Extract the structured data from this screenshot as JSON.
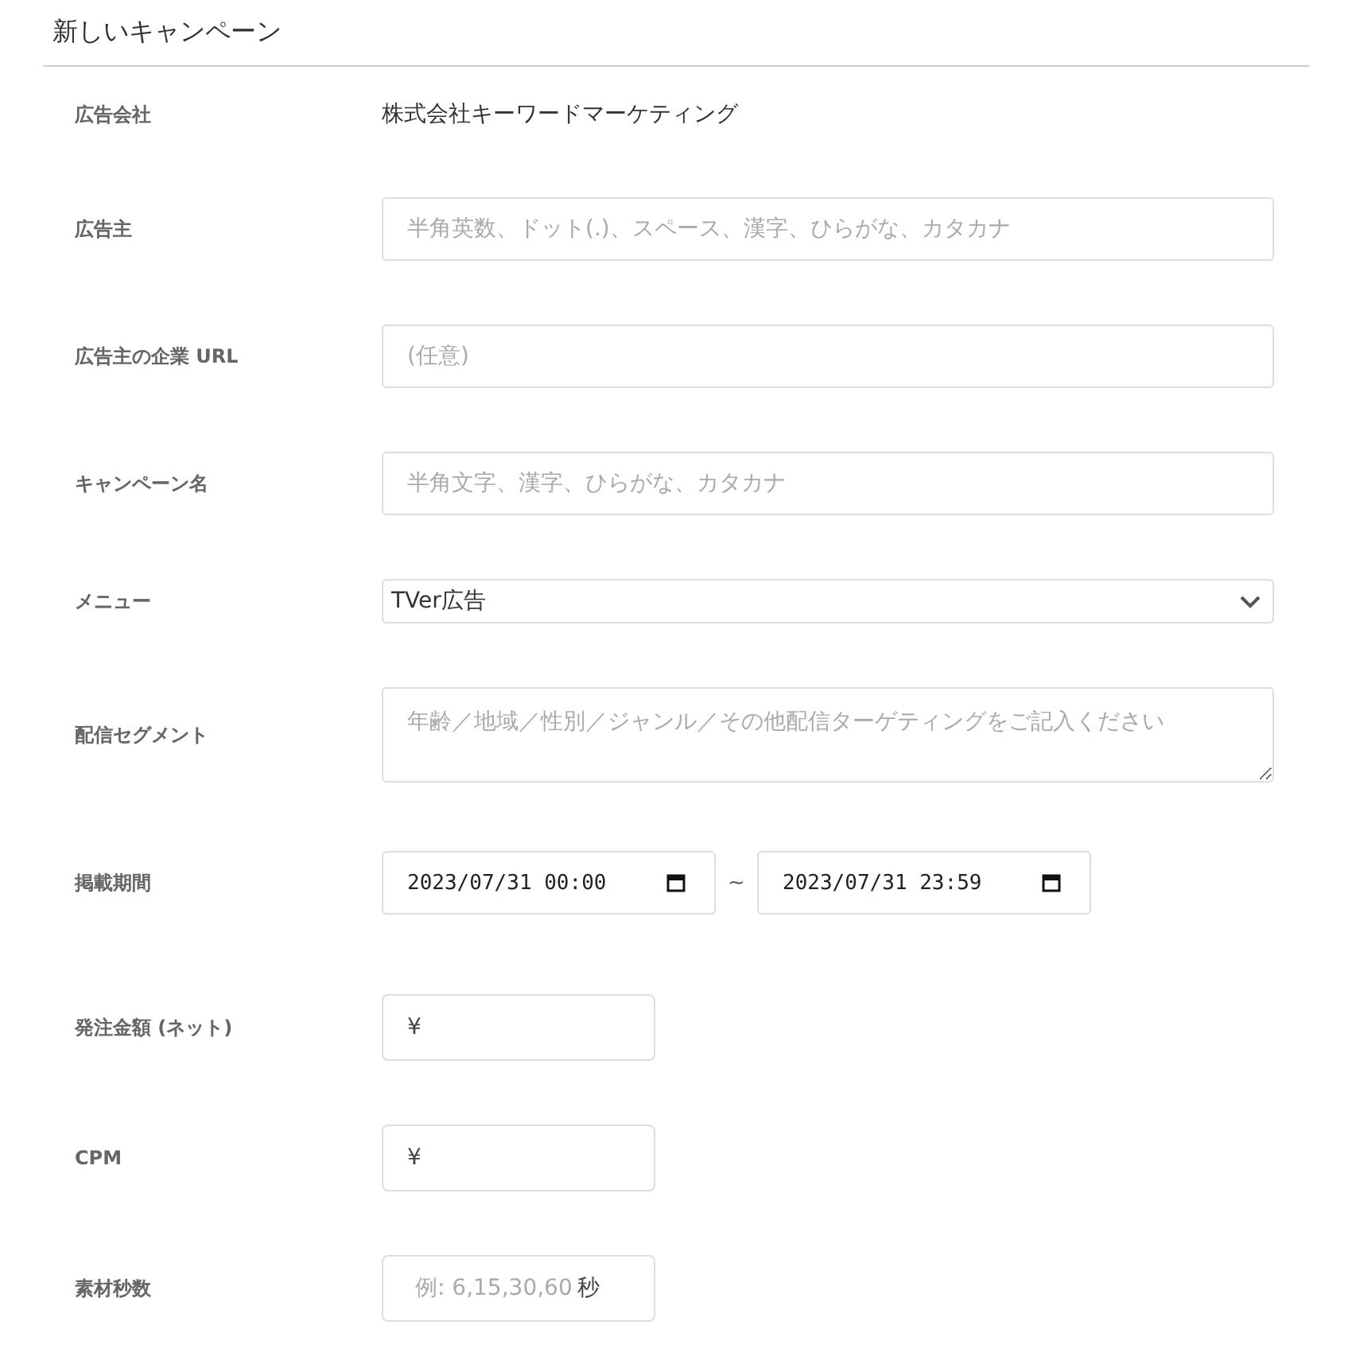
{
  "title": "新しいキャンペーン",
  "fields": [
    {
      "kind": "static",
      "label": "広告会社",
      "value": "株式会社キーワードマーケティング"
    },
    {
      "kind": "text",
      "label": "広告主",
      "placeholder": "半角英数、ドット(.)、スペース、漢字、ひらがな、カタカナ"
    },
    {
      "kind": "text",
      "label": "広告主の企業 URL",
      "placeholder": "(任意)"
    },
    {
      "kind": "text",
      "label": "キャンペーン名",
      "placeholder": "半角文字、漢字、ひらがな、カタカナ"
    },
    {
      "kind": "select",
      "label": "メニュー",
      "value": "TVer広告"
    },
    {
      "kind": "textarea",
      "label": "配信セグメント",
      "placeholder": "年齢／地域／性別／ジャンル／その他配信ターゲティングをご記入ください"
    },
    {
      "kind": "daterange",
      "label": "掲載期間",
      "start": "2023/07/31 00:00",
      "separator": "~",
      "end": "2023/07/31 23:59"
    },
    {
      "kind": "currency",
      "label": "発注金額 (ネット)",
      "prefix": "¥"
    },
    {
      "kind": "currency",
      "label": "CPM",
      "prefix": "¥"
    },
    {
      "kind": "seconds",
      "label": "素材秒数",
      "placeholder": "例: 6,15,30,60",
      "suffix": "秒"
    }
  ]
}
